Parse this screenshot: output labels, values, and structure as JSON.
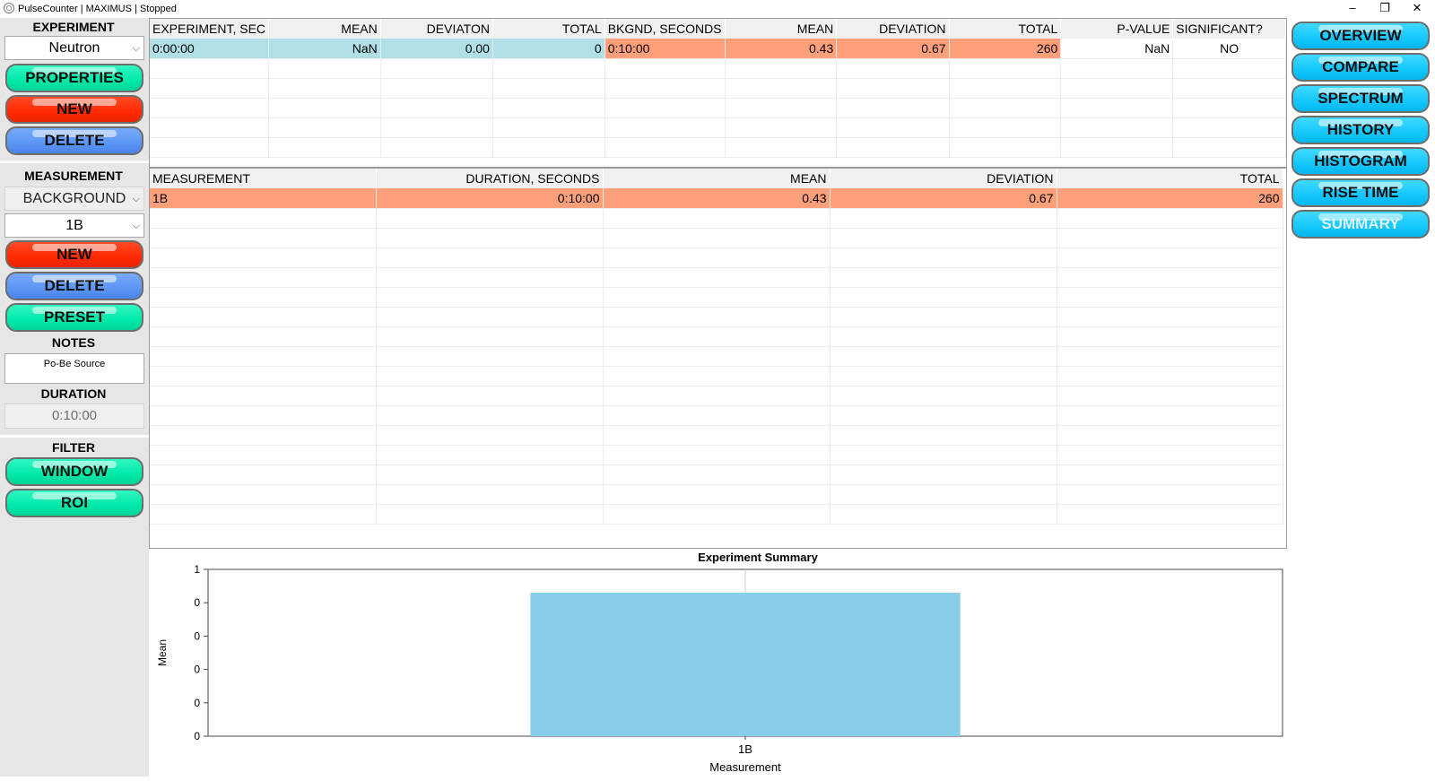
{
  "window": {
    "title": "PulseCounter | MAXIMUS | Stopped",
    "minimize": "–",
    "restore": "❐",
    "close": "✕"
  },
  "left": {
    "experiment_label": "EXPERIMENT",
    "experiment_value": "Neutron",
    "properties_btn": "PROPERTIES",
    "new_btn": "NEW",
    "delete_btn": "DELETE",
    "measurement_label": "MEASUREMENT",
    "measurement_type": "BACKGROUND",
    "measurement_value": "1B",
    "new2_btn": "NEW",
    "delete2_btn": "DELETE",
    "preset_btn": "PRESET",
    "notes_label": "NOTES",
    "notes_value": "Po-Be Source",
    "duration_label": "DURATION",
    "duration_value": "0:10:00",
    "filter_label": "FILTER",
    "window_btn": "WINDOW",
    "roi_btn": "ROI"
  },
  "right": {
    "buttons": [
      "OVERVIEW",
      "COMPARE",
      "SPECTRUM",
      "HISTORY",
      "HISTOGRAM",
      "RISE TIME",
      "SUMMARY"
    ],
    "active": "SUMMARY"
  },
  "summary_table": {
    "headers": [
      "EXPERIMENT, SEC",
      "MEAN",
      "DEVIATON",
      "TOTAL",
      "BKGND, SECONDS",
      "MEAN",
      "DEVIATION",
      "TOTAL",
      "P-VALUE",
      "SIGNIFICANT?"
    ],
    "rows": [
      [
        "0:00:00",
        "NaN",
        "0.00",
        "0",
        "0:10:00",
        "0.43",
        "0.67",
        "260",
        "NaN",
        "NO"
      ]
    ]
  },
  "measurement_table": {
    "headers": [
      "MEASUREMENT",
      "DURATION, SECONDS",
      "MEAN",
      "DEVIATION",
      "TOTAL"
    ],
    "rows": [
      [
        "1B",
        "0:10:00",
        "0.43",
        "0.67",
        "260"
      ]
    ]
  },
  "chart_data": {
    "type": "bar",
    "title": "Experiment Summary",
    "xlabel": "Measurement",
    "ylabel": "Mean",
    "categories": [
      "1B"
    ],
    "values": [
      0.43
    ],
    "error": [
      0.67
    ],
    "ylim": [
      0,
      0.5
    ],
    "yticks": [
      0,
      0.1,
      0.2,
      0.3,
      0.4,
      0.5
    ],
    "ytick_labels": [
      "0",
      "0",
      "0",
      "0",
      "0",
      "1"
    ],
    "bar_color": "#87ceeb",
    "grid": false,
    "legend": "none"
  }
}
